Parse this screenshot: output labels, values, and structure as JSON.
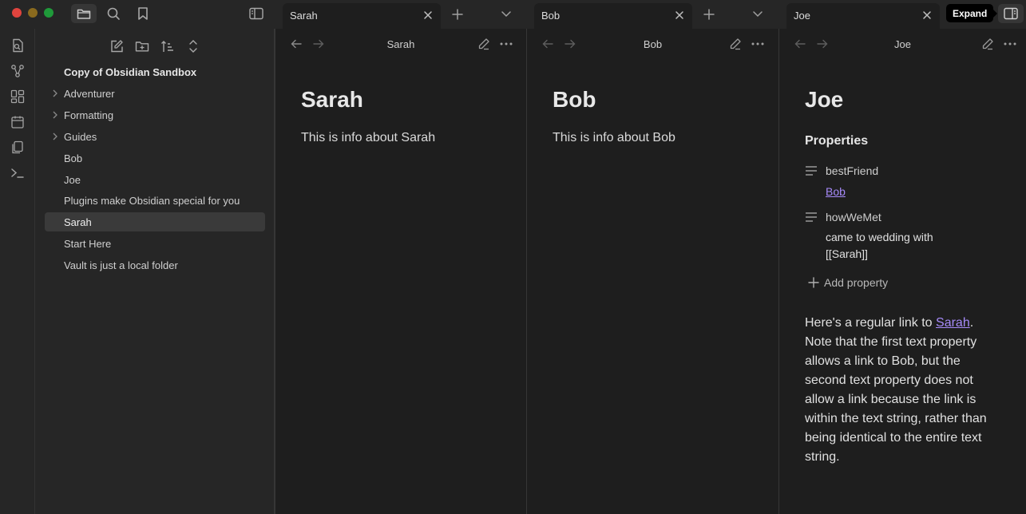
{
  "titlebar": {
    "traffic_colors": {
      "close": "#ff5f57",
      "minimize": "#febc2e",
      "zoom": "#28c840"
    }
  },
  "tabs": [
    {
      "title": "Sarah"
    },
    {
      "title": "Bob"
    },
    {
      "title": "Joe"
    }
  ],
  "tooltip": "Expand",
  "ribbon": {
    "icons": [
      "open-quick-switcher-icon",
      "graph-view-icon",
      "canvas-icon",
      "daily-note-icon",
      "templates-icon",
      "command-palette-icon"
    ]
  },
  "sidebar": {
    "tools": [
      "new-note-icon",
      "new-folder-icon",
      "sort-icon",
      "collapse-all-icon"
    ],
    "vault_name": "Copy of Obsidian Sandbox",
    "items": [
      {
        "label": "Adventurer",
        "folder": true
      },
      {
        "label": "Formatting",
        "folder": true
      },
      {
        "label": "Guides",
        "folder": true
      },
      {
        "label": "Bob",
        "folder": false
      },
      {
        "label": "Joe",
        "folder": false
      },
      {
        "label": "Plugins make Obsidian special for you",
        "folder": false
      },
      {
        "label": "Sarah",
        "folder": false,
        "selected": true
      },
      {
        "label": "Start Here",
        "folder": false
      },
      {
        "label": "Vault is just a local folder",
        "folder": false
      }
    ]
  },
  "panes": {
    "sarah": {
      "header_title": "Sarah",
      "doc_title": "Sarah",
      "text": "This is info about Sarah"
    },
    "bob": {
      "header_title": "Bob",
      "doc_title": "Bob",
      "text": "This is info about Bob"
    },
    "joe": {
      "header_title": "Joe",
      "doc_title": "Joe",
      "properties_title": "Properties",
      "properties": [
        {
          "key": "bestFriend",
          "value": "Bob",
          "is_link": true
        },
        {
          "key": "howWeMet",
          "value": "came to wedding with [[Sarah]]",
          "is_link": false
        }
      ],
      "add_property": "Add property",
      "body_before": "Here's a regular link to ",
      "body_link": "Sarah",
      "body_after": ". Note that the first text property allows a link to Bob, but the second text property does not allow a link because the link is within the text string, rather than being identical to the entire text string."
    }
  },
  "colors": {
    "accent_link": "#a68af9",
    "background": "#1e1e1e",
    "sidebar_bg": "#262626"
  }
}
